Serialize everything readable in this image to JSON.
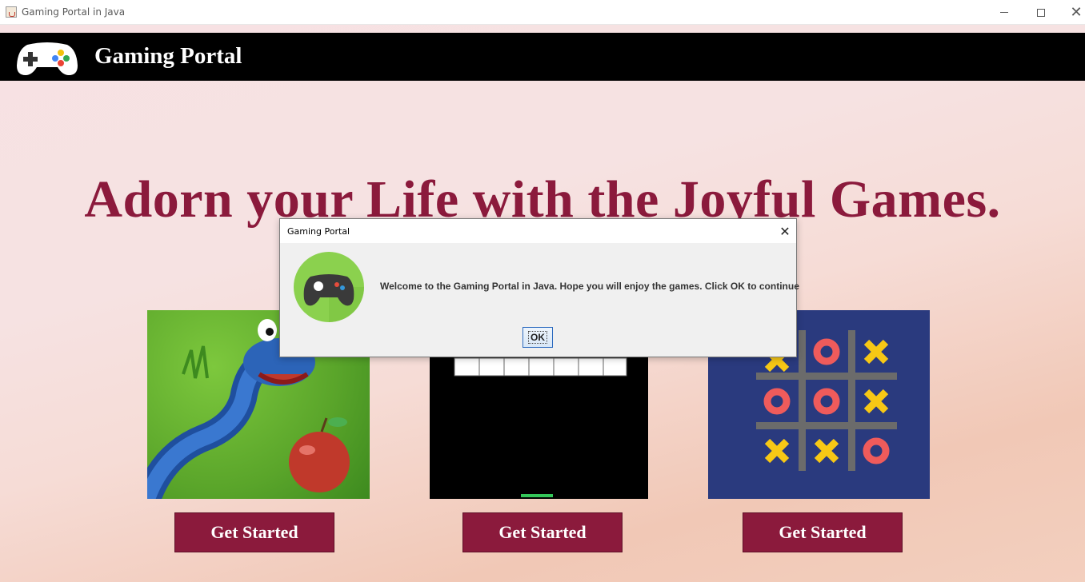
{
  "window": {
    "title": "Gaming Portal in Java"
  },
  "header": {
    "title": "Gaming Portal",
    "logo_icon": "gamepad-icon"
  },
  "hero": {
    "heading": "Adorn your Life with the Joyful Games."
  },
  "games": [
    {
      "image": "snake-game-image",
      "button_label": "Get Started"
    },
    {
      "image": "brick-breaker-game-image",
      "button_label": "Get Started"
    },
    {
      "image": "tic-tac-toe-game-image",
      "button_label": "Get Started"
    }
  ],
  "dialog": {
    "title": "Gaming Portal",
    "message": "Welcome to the Gaming Portal in Java. Hope you will enjoy the games. Click OK to continue",
    "ok_label": "OK",
    "icon": "gamepad-icon"
  },
  "colors": {
    "accent": "#8b1a3c",
    "header_bg": "#000000",
    "dialog_icon_bg": "#8bd14e",
    "ttt_bg": "#2a3a7e"
  }
}
